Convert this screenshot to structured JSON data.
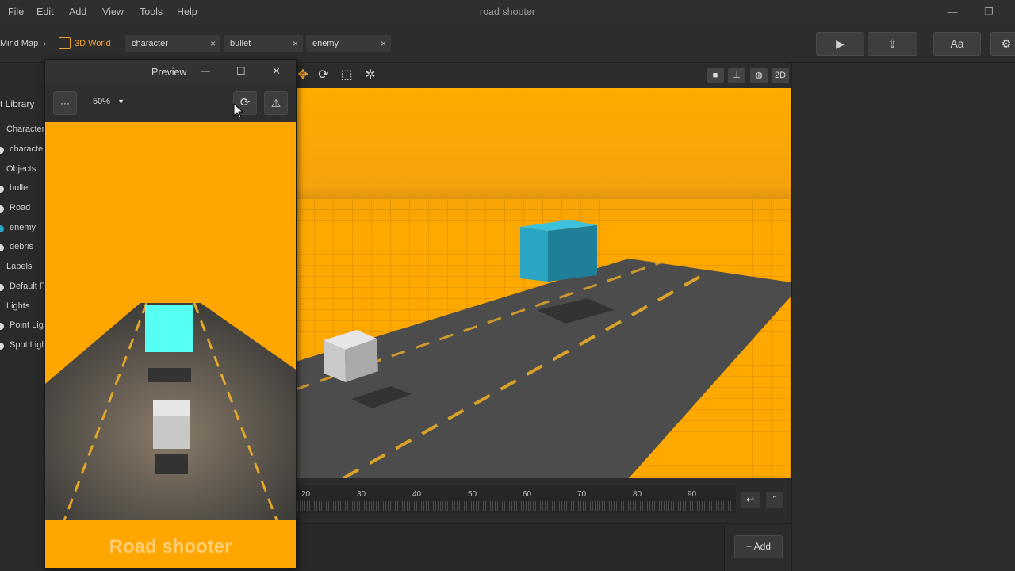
{
  "menu": [
    "File",
    "Edit",
    "Add",
    "View",
    "Tools",
    "Help"
  ],
  "app_title": "road shooter",
  "window_controls": {
    "minimize": "—",
    "restore": "❐"
  },
  "breadcrumb": {
    "mind_map": "Mind Map",
    "separator": "›",
    "world": "3D World"
  },
  "tabs": [
    {
      "label": "character",
      "close": "×"
    },
    {
      "label": "bullet",
      "close": "×"
    },
    {
      "label": "enemy",
      "close": "×"
    }
  ],
  "toolbar": {
    "play": "▶",
    "export": "⇪",
    "font": "Aa",
    "settings": "⚙"
  },
  "library": {
    "title": "t Library",
    "items": [
      {
        "label": "Characters",
        "icon": "folder-icon"
      },
      {
        "label": "character",
        "icon": "sphere-icon"
      },
      {
        "label": "Objects",
        "icon": "folder-icon"
      },
      {
        "label": "bullet",
        "icon": "sphere-icon"
      },
      {
        "label": "Road",
        "icon": "road-icon"
      },
      {
        "label": "enemy",
        "icon": "sphere-icon"
      },
      {
        "label": "debris",
        "icon": "sphere-icon"
      },
      {
        "label": "Labels",
        "icon": "folder-icon"
      },
      {
        "label": "Default F",
        "icon": "label-icon"
      },
      {
        "label": "Lights",
        "icon": "folder-icon"
      },
      {
        "label": "Point Ligh",
        "icon": "light-icon"
      },
      {
        "label": "Spot Ligh",
        "icon": "light-icon"
      }
    ]
  },
  "preview": {
    "title": "Preview",
    "zoom": "50%",
    "menu_dots": "···",
    "minimize": "—",
    "maximize": "☐",
    "close": "✕",
    "game_title": "Road shooter"
  },
  "viewport": {
    "mode_2d": "2D"
  },
  "timeline": {
    "ticks": [
      "20",
      "30",
      "40",
      "50",
      "60",
      "70",
      "80",
      "90"
    ]
  },
  "bottom": {
    "add_label": "Add"
  },
  "colors": {
    "accent": "#f0a030",
    "ground": "#ffa800",
    "road": "#4a4a4a",
    "enemy": "#2aa6c4",
    "enemy_preview": "#55fff2"
  }
}
